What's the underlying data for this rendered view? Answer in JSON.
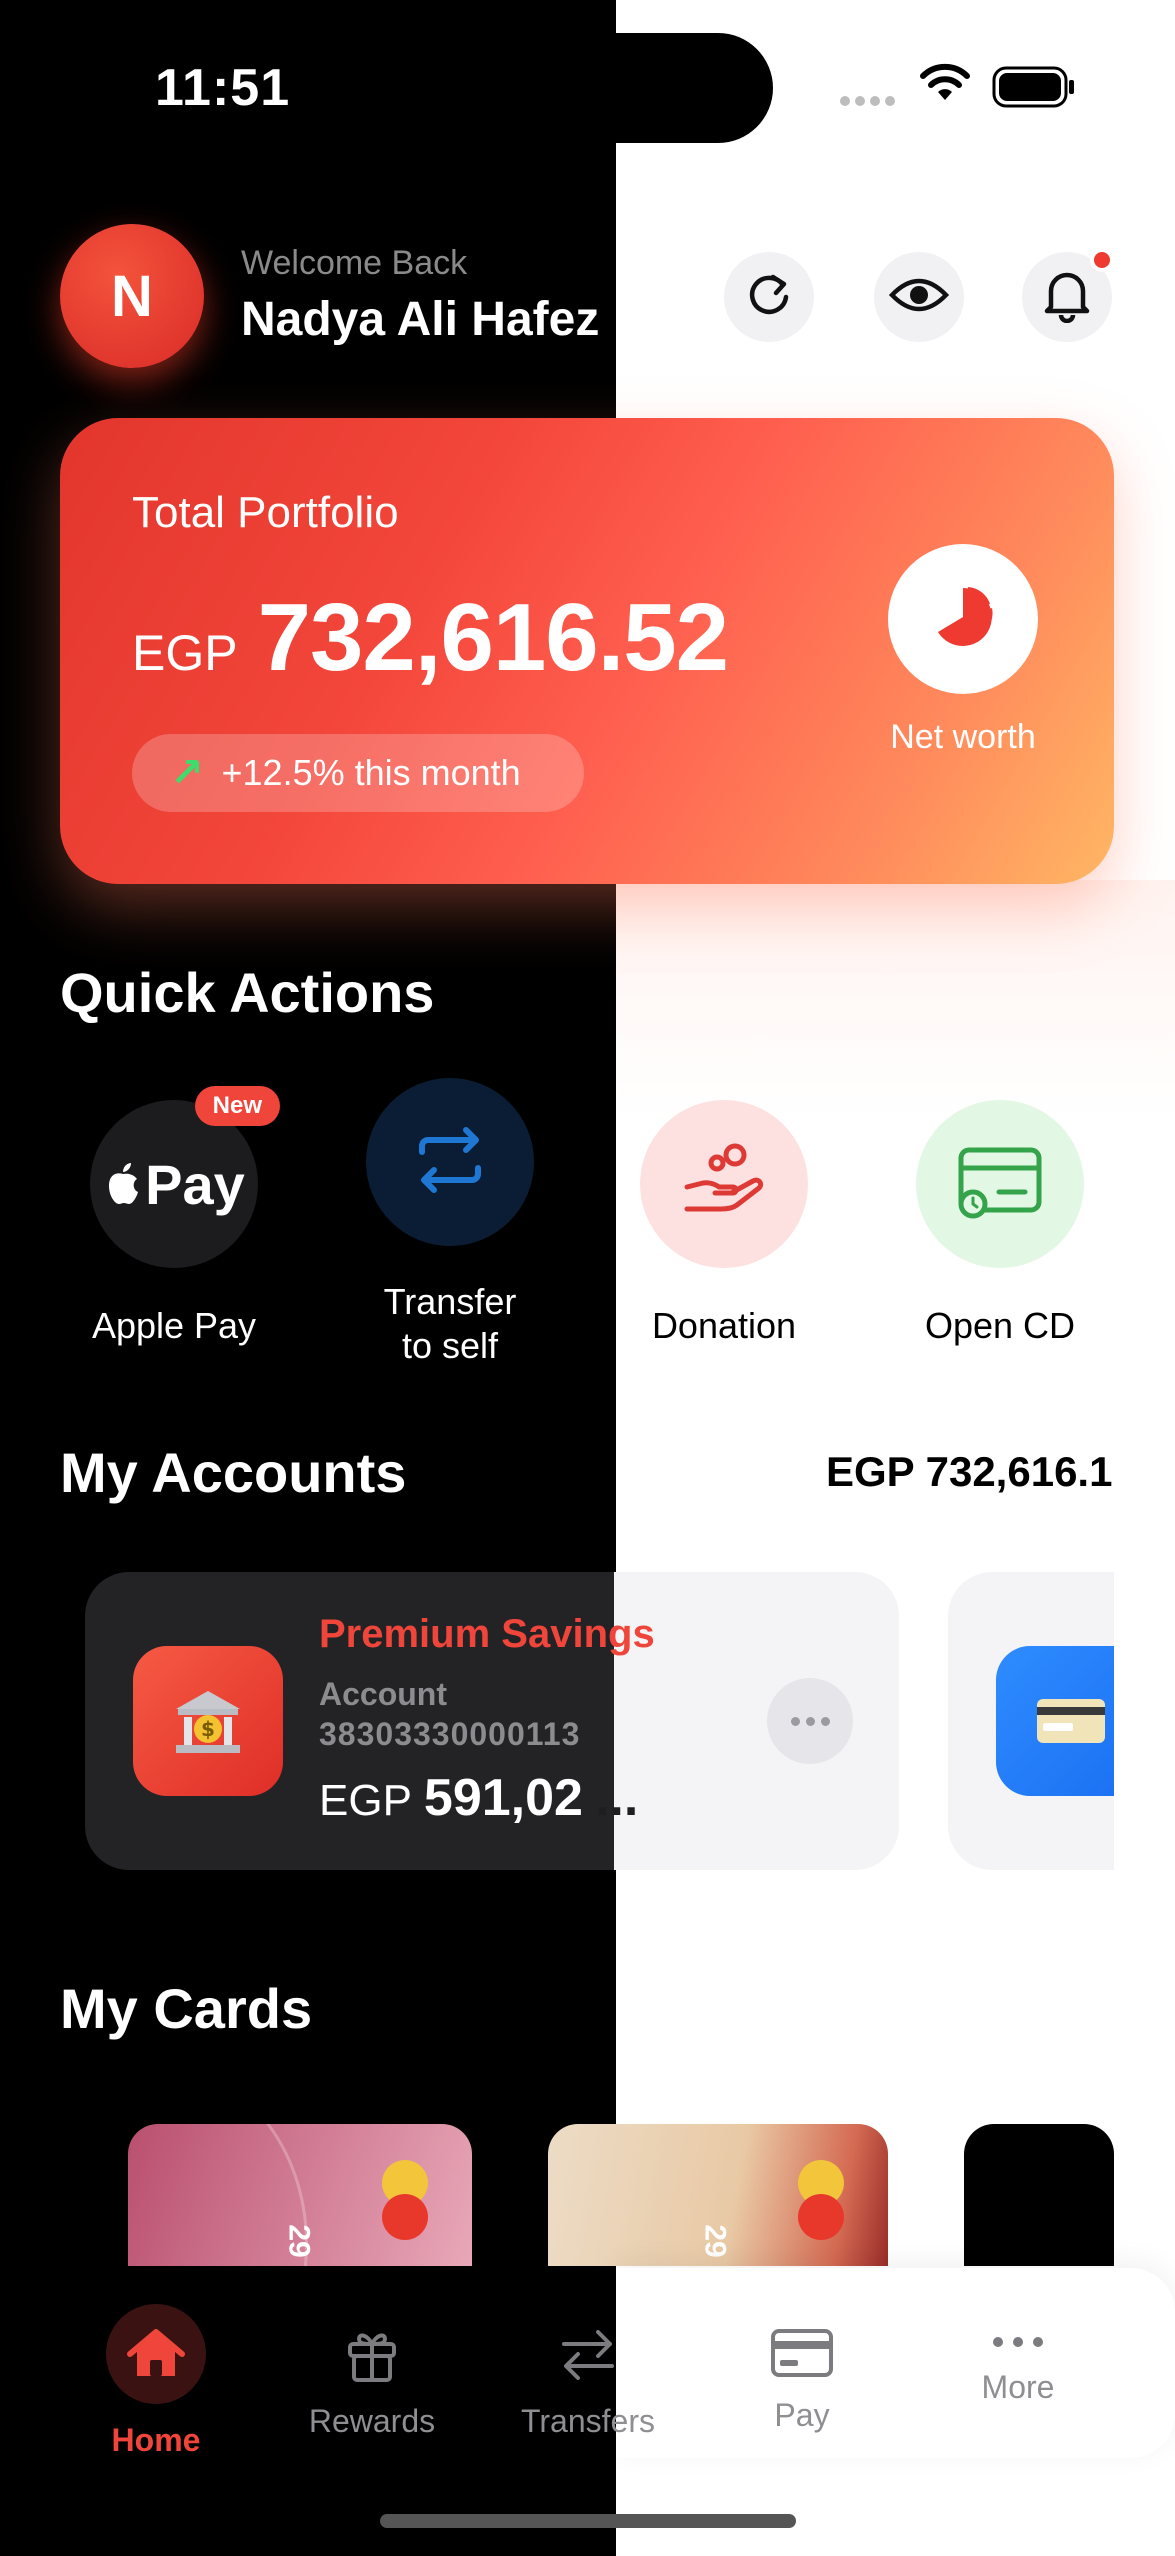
{
  "status_bar": {
    "time": "11:51"
  },
  "header": {
    "avatar_initial": "N",
    "welcome": "Welcome Back",
    "user_name": "Nadya Ali Hafez"
  },
  "portfolio": {
    "title": "Total Portfolio",
    "currency": "EGP",
    "amount": "732,616.52",
    "change": "+12.5% this month",
    "net_worth_label": "Net worth"
  },
  "quick_actions": {
    "title": "Quick Actions",
    "items": [
      {
        "label": "Apple Pay",
        "badge": "New",
        "icon_text": "Pay"
      },
      {
        "label_line1": "Transfer",
        "label_line2": "to self"
      },
      {
        "label": "Donation"
      },
      {
        "label": "Open CD"
      }
    ]
  },
  "accounts": {
    "title": "My Accounts",
    "total": "EGP 732,616.1",
    "items": [
      {
        "name": "Premium Savings",
        "type": "Account",
        "number": "38303330000113",
        "currency": "EGP",
        "balance": "591,02",
        "ellipsis": "..."
      }
    ]
  },
  "cards": {
    "title": "My Cards",
    "items": [
      {
        "number_fragment": "29"
      },
      {
        "number_fragment": "29"
      }
    ]
  },
  "tabbar": {
    "items": [
      {
        "label": "Home",
        "active": true
      },
      {
        "label": "Rewards"
      },
      {
        "label": "Transfers"
      },
      {
        "label": "Pay"
      },
      {
        "label": "More"
      }
    ]
  },
  "colors": {
    "accent": "#f0453a",
    "portfolio_gradient_start": "#e2352c",
    "portfolio_gradient_end": "#ffb764",
    "positive": "#3ddc6b"
  }
}
